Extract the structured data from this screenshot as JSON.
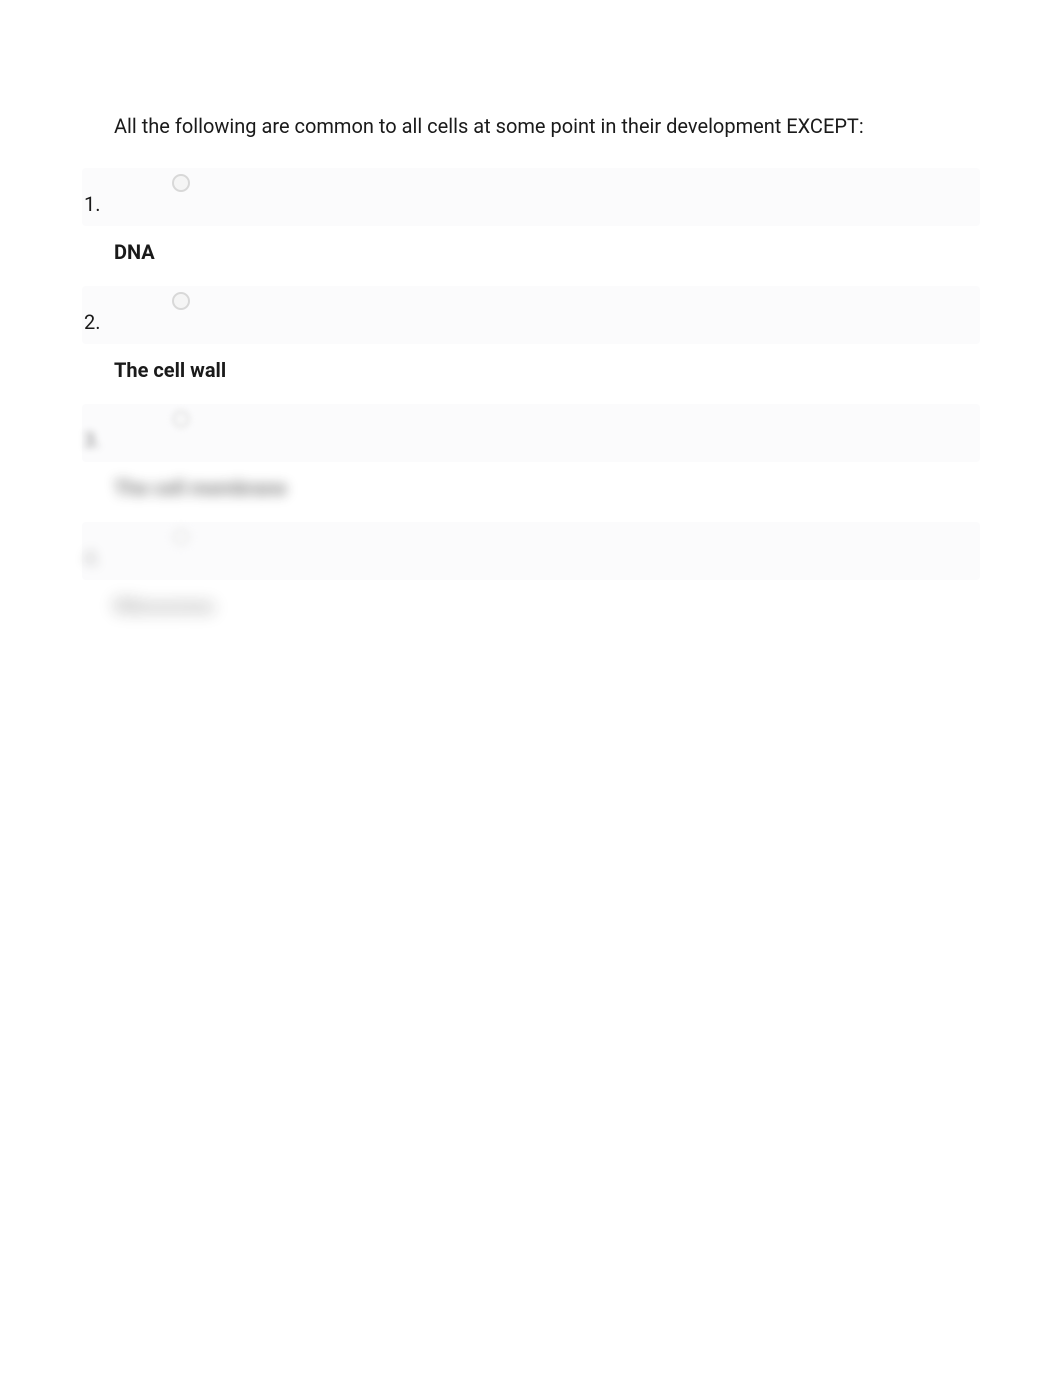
{
  "question": {
    "prompt": "All the following are common to all cells at some point in their development EXCEPT:",
    "options": [
      {
        "number": "1.",
        "label": "DNA",
        "blur": "none"
      },
      {
        "number": "2.",
        "label": "The cell wall",
        "blur": "none"
      },
      {
        "number": "3.",
        "label": "The cell membrane",
        "blur": "light"
      },
      {
        "number": "4.",
        "label": "Ribosomes",
        "blur": "heavy"
      }
    ]
  }
}
